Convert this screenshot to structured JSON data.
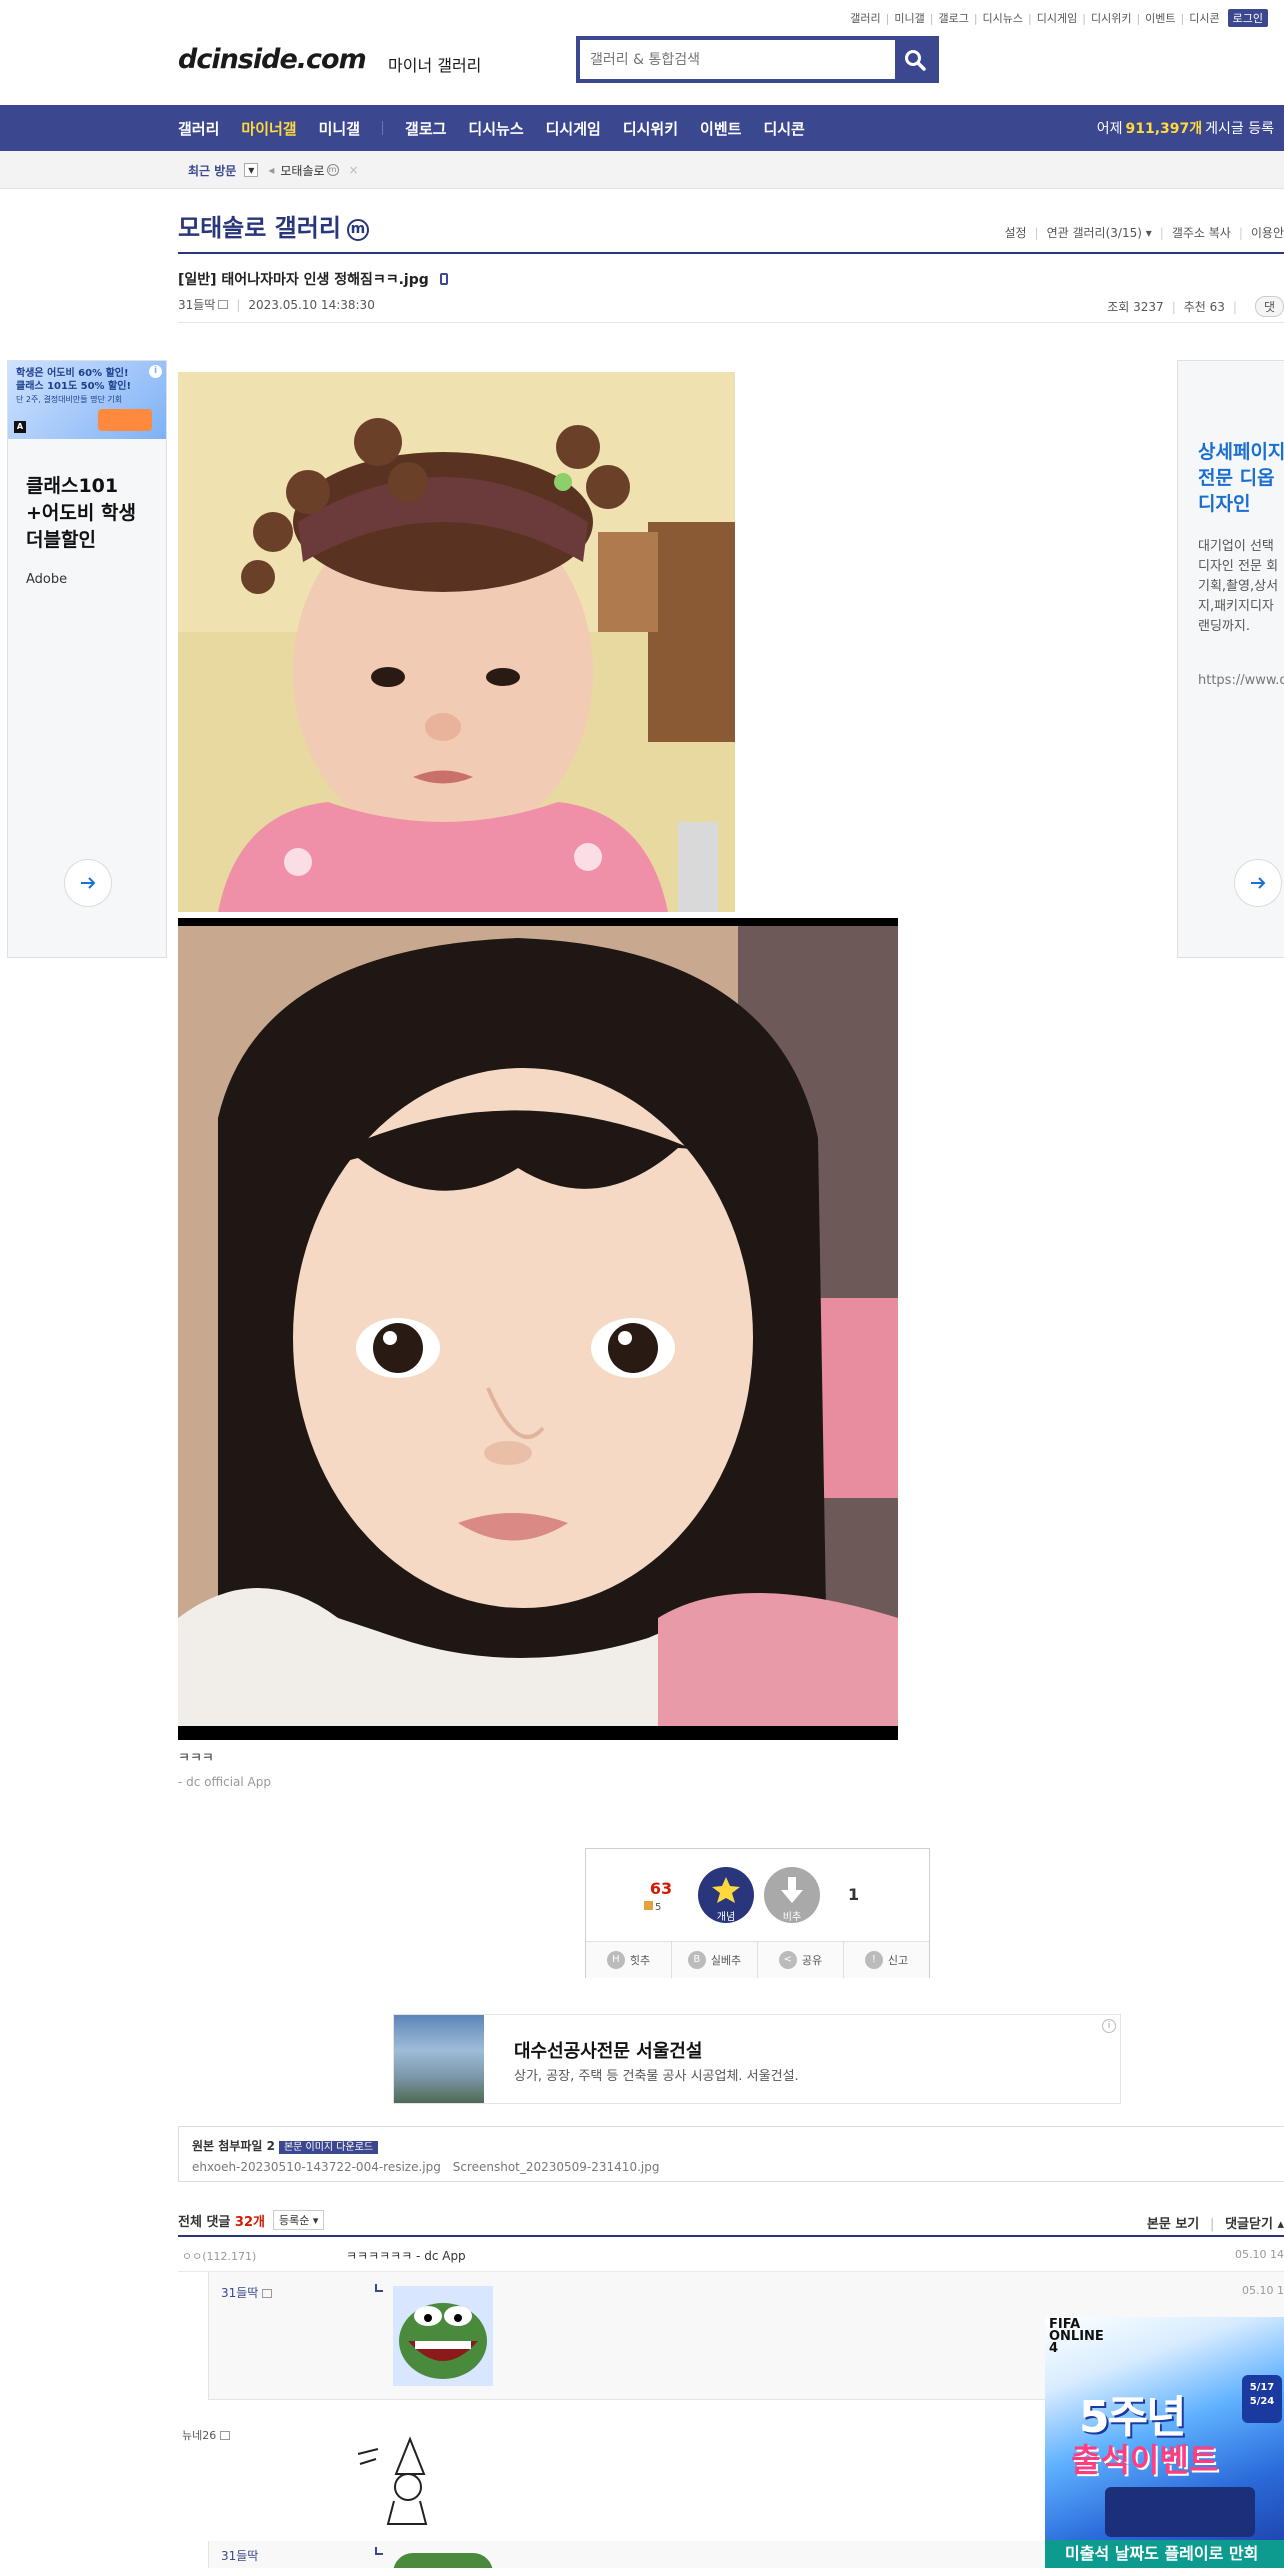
{
  "util_links": [
    "갤러리",
    "미니갤",
    "갤로그",
    "디시뉴스",
    "디시게임",
    "디시위키",
    "이벤트",
    "디시콘"
  ],
  "login_label": "로그인",
  "logo": {
    "text": "dcinside.com",
    "sub": "마이너 갤러리"
  },
  "search": {
    "placeholder": "갤러리 & 통합검색"
  },
  "gnb": {
    "items": [
      "갤러리",
      "마이너갤",
      "미니갤",
      "갤로그",
      "디시뉴스",
      "디시게임",
      "디시위키",
      "이벤트",
      "디시콘"
    ],
    "active": "마이너갤",
    "stat_prefix": "어제",
    "stat_value": "911,397개",
    "stat_suffix": "게시글 등록"
  },
  "recent": {
    "label": "최근 방문",
    "item": "모태솔로"
  },
  "gallery": {
    "title": "모태솔로 갤러리",
    "badge": "m",
    "options": [
      "설정",
      "연관 갤러리(3/15)",
      "갤주소 복사",
      "이용안"
    ]
  },
  "post": {
    "title": "[일반] 태어나자마자 인생 정해짐ㅋㅋ.jpg",
    "author": "31들딱",
    "datetime": "2023.05.10 14:38:30",
    "views_label": "조회 3237",
    "recommend_label": "추천 63",
    "comment_btn": "댓",
    "body_text": "ㅋㅋㅋ",
    "app_text": "- dc official App"
  },
  "left_ad": {
    "banner_line1": "학생은 어도비 60% 할인!",
    "banner_line2": "클래스 101도 50% 할인!",
    "banner_line3": "단 2주, 결정대비만들 명단 기회",
    "headline": [
      "클래스101",
      "+어도비 학생",
      "더블할인"
    ],
    "brand": "Adobe"
  },
  "right_ad": {
    "headline": [
      "상세페이지",
      "전문 디옵",
      "디자인"
    ],
    "desc": [
      "대기업이 선택",
      "디자인 전문 회",
      "기획,촬영,상서",
      "지,패키지디자",
      "랜딩까지."
    ],
    "url": "https://www.d"
  },
  "recommend": {
    "up_count": "63",
    "up_sub": "5",
    "up_label": "개념",
    "down_label": "비추",
    "down_count": "1",
    "actions": [
      "힛추",
      "실베추",
      "공유",
      "신고"
    ]
  },
  "mid_ad": {
    "title": "대수선공사전문 서울건설",
    "desc": "상가, 공장, 주택 등 건축물 공사 시공업체. 서울건설.",
    "info": "i"
  },
  "attachments": {
    "title": "원본 첨부파일 2",
    "download_label": "본문 이미지 다운로드",
    "files": [
      "ehxoeh-20230510-143722-004-resize.jpg",
      "Screenshot_20230509-231410.jpg"
    ]
  },
  "comments": {
    "label": "전체 댓글",
    "count": "32개",
    "sort": "등록순",
    "view_body": "본문 보기",
    "close": "댓글닫기",
    "rows": [
      {
        "nick": "ㅇㅇ(112.171)",
        "text": "ㅋㅋㅋㅋㅋㅋ - dc App",
        "date": "05.10 14"
      },
      {
        "nick": "31들딱",
        "date": "05.10 1"
      },
      {
        "nick": "뉴네26"
      },
      {
        "nick": "31들딱"
      }
    ]
  },
  "fifa_ad": {
    "logo": "FIFA ONLINE 4",
    "big": "5주년",
    "big2": "출석이벤트",
    "dates": [
      "5/17",
      "5/24"
    ],
    "bottom": "미출석 날짜도 플레이로 만회"
  }
}
